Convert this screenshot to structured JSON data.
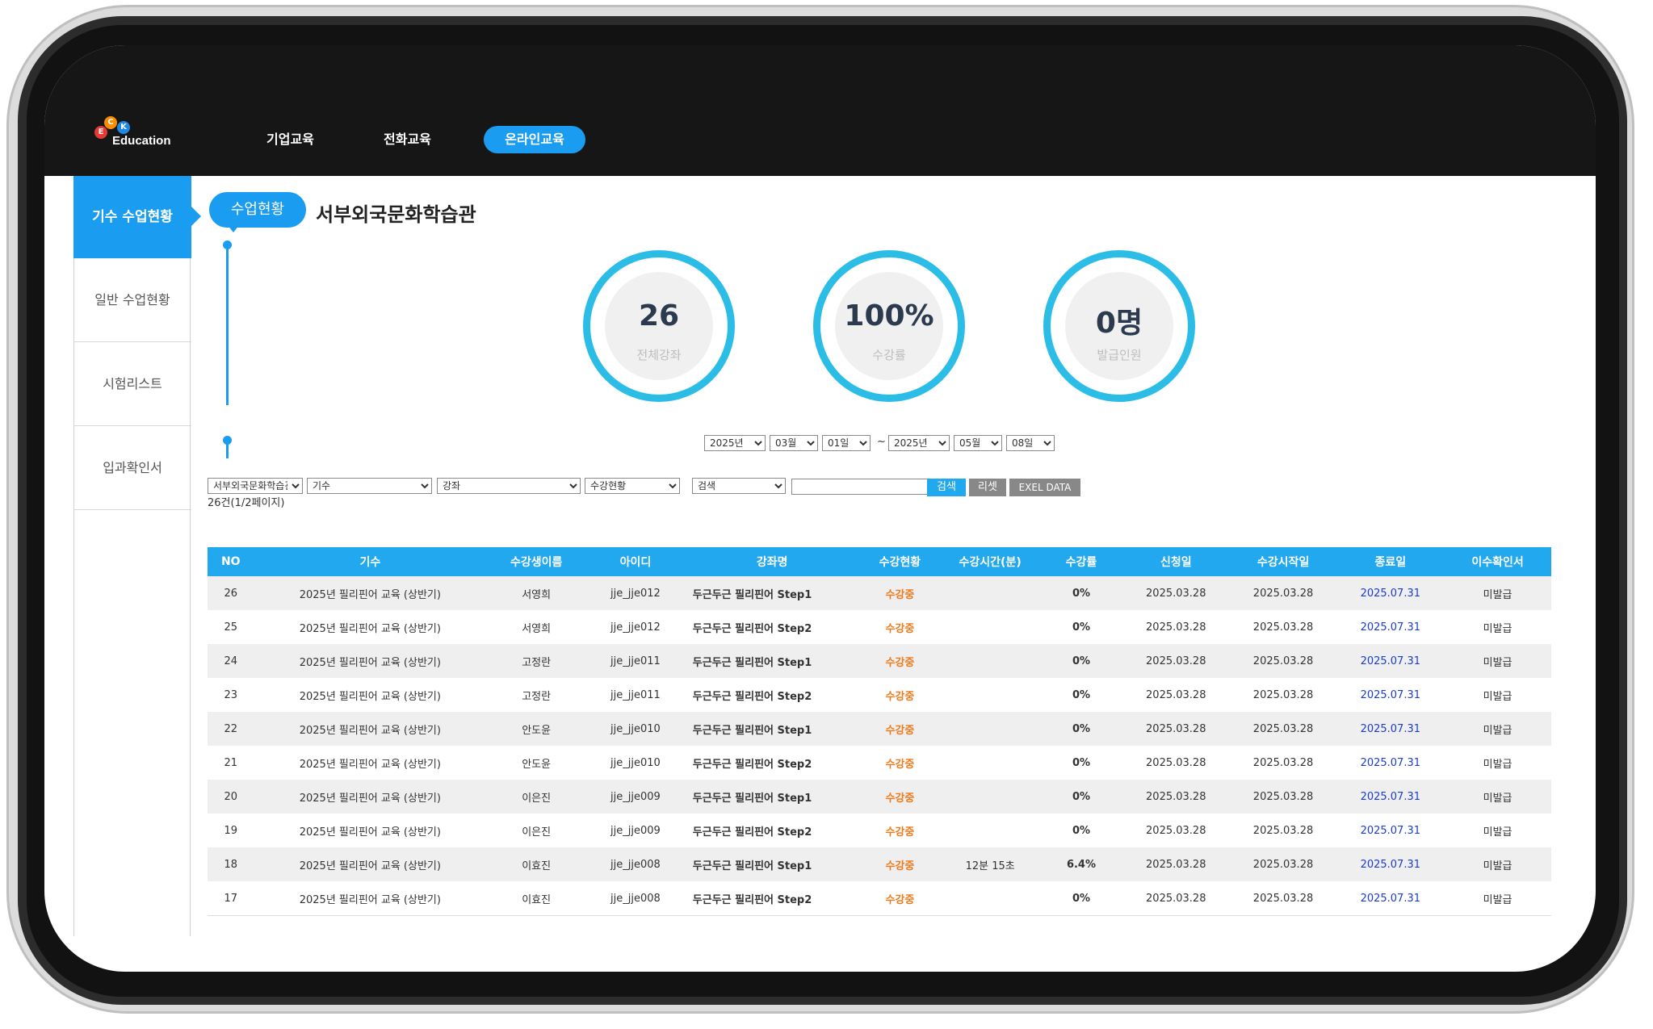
{
  "brand": {
    "logo_text": "Education",
    "logo_letters": [
      "E",
      "C",
      "K"
    ]
  },
  "nav": {
    "items": [
      "기업교육",
      "전화교육",
      "온라인교육"
    ],
    "active": "온라인교육"
  },
  "sidebar": {
    "items": [
      "기수 수업현황",
      "일반 수업현황",
      "시험리스트",
      "입과확인서"
    ],
    "active": "기수 수업현황"
  },
  "header": {
    "pill": "수업현황",
    "title": "서부외국문화학습관"
  },
  "stats": [
    {
      "value": "26",
      "label": "전체강좌"
    },
    {
      "value": "100%",
      "label": "수강률"
    },
    {
      "value": "0명",
      "label": "발급인원"
    }
  ],
  "date_range": {
    "start": {
      "year": "2025년",
      "month": "03월",
      "day": "01일"
    },
    "separator": "~",
    "end": {
      "year": "2025년",
      "month": "05월",
      "day": "08일"
    }
  },
  "filters": {
    "org": "서부외국문화학습관",
    "cohort": "기수",
    "course": "강좌",
    "status": "수강현황",
    "search_type": "검색",
    "search_value": "",
    "search_button": "검색",
    "reset_button": "리셋",
    "excel_button": "EXEL DATA"
  },
  "result_count": "26건(1/2페이지)",
  "table": {
    "headers": [
      "NO",
      "기수",
      "수강생이름",
      "아이디",
      "강좌명",
      "수강현황",
      "수강시간(분)",
      "수강률",
      "신청일",
      "수강시작일",
      "종료일",
      "이수확인서"
    ],
    "rows": [
      {
        "no": "26",
        "cohort": "2025년 필리핀어 교육 (상반기)",
        "name": "서영희",
        "id": "jje_jje012",
        "course": "두근두근 필리핀어 Step1",
        "status": "수강중",
        "time": "",
        "rate": "0%",
        "applied": "2025.03.28",
        "start": "2025.03.28",
        "end": "2025.07.31",
        "cert": "미발급"
      },
      {
        "no": "25",
        "cohort": "2025년 필리핀어 교육 (상반기)",
        "name": "서영희",
        "id": "jje_jje012",
        "course": "두근두근 필리핀어 Step2",
        "status": "수강중",
        "time": "",
        "rate": "0%",
        "applied": "2025.03.28",
        "start": "2025.03.28",
        "end": "2025.07.31",
        "cert": "미발급"
      },
      {
        "no": "24",
        "cohort": "2025년 필리핀어 교육 (상반기)",
        "name": "고정란",
        "id": "jje_jje011",
        "course": "두근두근 필리핀어 Step1",
        "status": "수강중",
        "time": "",
        "rate": "0%",
        "applied": "2025.03.28",
        "start": "2025.03.28",
        "end": "2025.07.31",
        "cert": "미발급"
      },
      {
        "no": "23",
        "cohort": "2025년 필리핀어 교육 (상반기)",
        "name": "고정란",
        "id": "jje_jje011",
        "course": "두근두근 필리핀어 Step2",
        "status": "수강중",
        "time": "",
        "rate": "0%",
        "applied": "2025.03.28",
        "start": "2025.03.28",
        "end": "2025.07.31",
        "cert": "미발급"
      },
      {
        "no": "22",
        "cohort": "2025년 필리핀어 교육 (상반기)",
        "name": "안도윤",
        "id": "jje_jje010",
        "course": "두근두근 필리핀어 Step1",
        "status": "수강중",
        "time": "",
        "rate": "0%",
        "applied": "2025.03.28",
        "start": "2025.03.28",
        "end": "2025.07.31",
        "cert": "미발급"
      },
      {
        "no": "21",
        "cohort": "2025년 필리핀어 교육 (상반기)",
        "name": "안도윤",
        "id": "jje_jje010",
        "course": "두근두근 필리핀어 Step2",
        "status": "수강중",
        "time": "",
        "rate": "0%",
        "applied": "2025.03.28",
        "start": "2025.03.28",
        "end": "2025.07.31",
        "cert": "미발급"
      },
      {
        "no": "20",
        "cohort": "2025년 필리핀어 교육 (상반기)",
        "name": "이은진",
        "id": "jje_jje009",
        "course": "두근두근 필리핀어 Step1",
        "status": "수강중",
        "time": "",
        "rate": "0%",
        "applied": "2025.03.28",
        "start": "2025.03.28",
        "end": "2025.07.31",
        "cert": "미발급"
      },
      {
        "no": "19",
        "cohort": "2025년 필리핀어 교육 (상반기)",
        "name": "이은진",
        "id": "jje_jje009",
        "course": "두근두근 필리핀어 Step2",
        "status": "수강중",
        "time": "",
        "rate": "0%",
        "applied": "2025.03.28",
        "start": "2025.03.28",
        "end": "2025.07.31",
        "cert": "미발급"
      },
      {
        "no": "18",
        "cohort": "2025년 필리핀어 교육 (상반기)",
        "name": "이효진",
        "id": "jje_jje008",
        "course": "두근두근 필리핀어 Step1",
        "status": "수강중",
        "time": "12분 15초",
        "rate": "6.4%",
        "applied": "2025.03.28",
        "start": "2025.03.28",
        "end": "2025.07.31",
        "cert": "미발급"
      },
      {
        "no": "17",
        "cohort": "2025년 필리핀어 교육 (상반기)",
        "name": "이효진",
        "id": "jje_jje008",
        "course": "두근두근 필리핀어 Step2",
        "status": "수강중",
        "time": "",
        "rate": "0%",
        "applied": "2025.03.28",
        "start": "2025.03.28",
        "end": "2025.07.31",
        "cert": "미발급"
      }
    ]
  },
  "colors": {
    "accent": "#1a9cf0",
    "ring": "#2bbde6",
    "status": "#f07a1a",
    "end_date": "#1a3ccf",
    "topbar": "#161616"
  }
}
